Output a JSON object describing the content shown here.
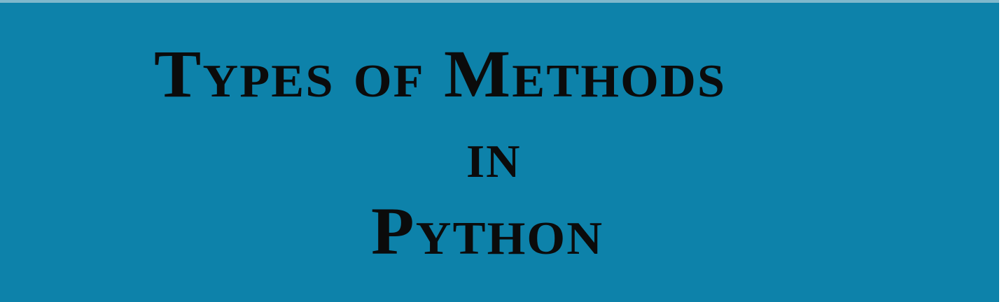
{
  "slide": {
    "title_line_1": "Types of Methods",
    "title_line_2": "in",
    "title_line_3": "Python"
  },
  "colors": {
    "background": "#0d82aa",
    "text": "#0b0b0b"
  }
}
